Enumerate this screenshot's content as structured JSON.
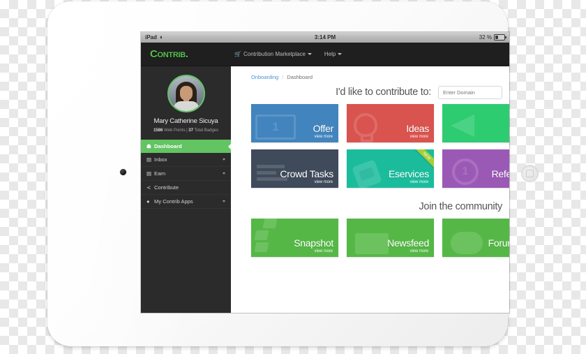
{
  "device": {
    "type": "tablet-frame",
    "home_button": "home-button",
    "camera": "front-camera"
  },
  "status_bar": {
    "carrier_label": "iPad",
    "wifi_icon": "wifi-icon",
    "time": "3:14 PM",
    "battery_percent": "32 %",
    "battery_level": 32
  },
  "topbar": {
    "brand": "Contrib.",
    "nav": [
      {
        "label": "Contribution Marketplace",
        "icon": "cart-icon",
        "has_dropdown": true
      },
      {
        "label": "Help",
        "icon": "",
        "has_dropdown": true
      }
    ]
  },
  "sidebar": {
    "user_name": "Mary Catherine Sicuya",
    "stats_points": "1586",
    "stats_points_label": " Web Points | ",
    "stats_badges": "37",
    "stats_badges_label": " Total Badges",
    "items": [
      {
        "label": "Dashboard",
        "icon": "home-icon",
        "active": true,
        "has_caret": false
      },
      {
        "label": "Inbox",
        "icon": "inbox-icon",
        "active": false,
        "has_caret": true
      },
      {
        "label": "Earn",
        "icon": "earn-icon",
        "active": false,
        "has_caret": true
      },
      {
        "label": "Contribute",
        "icon": "share-icon",
        "active": false,
        "has_caret": false
      },
      {
        "label": "My Contrib Apps",
        "icon": "circle-icon",
        "active": false,
        "has_caret": true
      }
    ]
  },
  "breadcrumb": {
    "parent": "Onboarding",
    "separator": "/",
    "current": "Dashboard"
  },
  "main": {
    "contribute_heading": "I'd like to contribute to:",
    "domain_placeholder": "Enter Domain",
    "domain_value": "",
    "community_heading": "Join the community",
    "view_more_label": "view more",
    "tiles_row1": [
      {
        "label": "Offer",
        "color": "#4284bd",
        "watermark": "banknote-icon"
      },
      {
        "label": "Ideas",
        "color": "#d9534f",
        "watermark": "lightbulb-icon"
      },
      {
        "label": "",
        "color": "#2ecc71",
        "watermark": "megaphone-icon"
      }
    ],
    "tiles_row2": [
      {
        "label": "Crowd Tasks",
        "color": "#3f4a5a",
        "watermark": "list-icon"
      },
      {
        "label": "Eservices",
        "color": "#1abc9c",
        "watermark": "document-icon",
        "ribbon": "NEW"
      },
      {
        "label": "Referral",
        "color": "#9b59b6",
        "watermark": "scale-icon"
      }
    ],
    "tiles_row3": [
      {
        "label": "Snapshot",
        "color": "#55b846",
        "watermark": "cubes-icon"
      },
      {
        "label": "Newsfeed",
        "color": "#55b846",
        "watermark": "screen-icon"
      },
      {
        "label": "Forum D",
        "color": "#55b846",
        "watermark": "bubble-icon"
      }
    ]
  },
  "colors": {
    "brand_green": "#54c14e",
    "sidebar_bg": "#2b2b2b",
    "topbar_bg": "#1f1f1f",
    "active_green": "#62c462",
    "link_blue": "#4a8fd4"
  }
}
